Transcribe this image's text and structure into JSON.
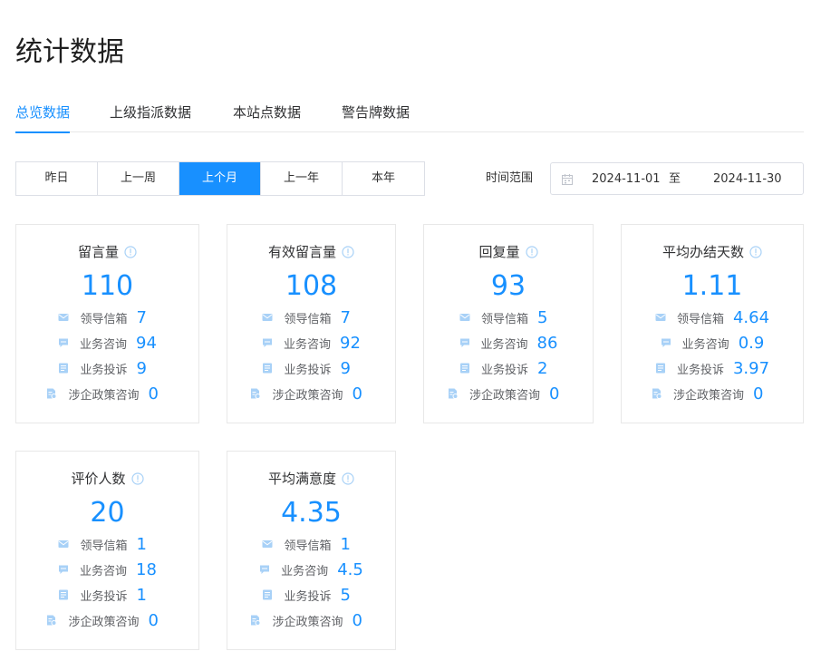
{
  "page": {
    "title": "统计数据"
  },
  "tabs": [
    {
      "label": "总览数据",
      "active": true
    },
    {
      "label": "上级指派数据",
      "active": false
    },
    {
      "label": "本站点数据",
      "active": false
    },
    {
      "label": "警告牌数据",
      "active": false
    }
  ],
  "periods": [
    {
      "label": "昨日",
      "active": false
    },
    {
      "label": "上一周",
      "active": false
    },
    {
      "label": "上个月",
      "active": true
    },
    {
      "label": "上一年",
      "active": false
    },
    {
      "label": "本年",
      "active": false
    }
  ],
  "date_range": {
    "label": "时间范围",
    "start": "2024-11-01",
    "separator": "至",
    "end": "2024-11-30"
  },
  "row_labels": {
    "mailbox": "领导信箱",
    "consult": "业务咨询",
    "complaint": "业务投诉",
    "policy": "涉企政策咨询"
  },
  "cards": [
    {
      "title": "留言量",
      "total": "110",
      "mailbox": "7",
      "consult": "94",
      "complaint": "9",
      "policy": "0"
    },
    {
      "title": "有效留言量",
      "total": "108",
      "mailbox": "7",
      "consult": "92",
      "complaint": "9",
      "policy": "0"
    },
    {
      "title": "回复量",
      "total": "93",
      "mailbox": "5",
      "consult": "86",
      "complaint": "2",
      "policy": "0"
    },
    {
      "title": "平均办结天数",
      "total": "1.11",
      "mailbox": "4.64",
      "consult": "0.9",
      "complaint": "3.97",
      "policy": "0"
    },
    {
      "title": "评价人数",
      "total": "20",
      "mailbox": "1",
      "consult": "18",
      "complaint": "1",
      "policy": "0"
    },
    {
      "title": "平均满意度",
      "total": "4.35",
      "mailbox": "1",
      "consult": "4.5",
      "complaint": "5",
      "policy": "0"
    }
  ],
  "colors": {
    "accent": "#1890ff",
    "icon": "#a8d1f7",
    "border": "#e8e8e8"
  }
}
